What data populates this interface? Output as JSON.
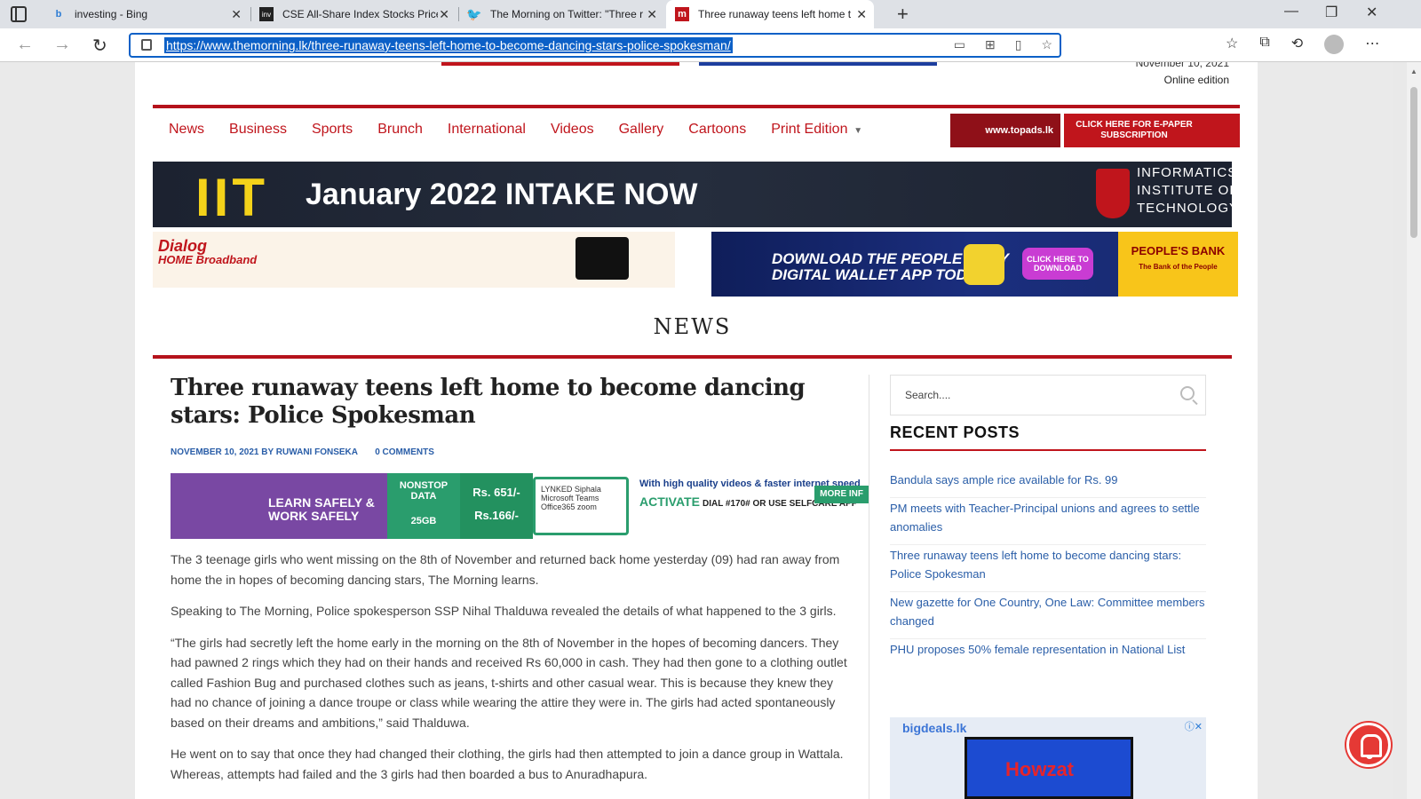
{
  "browser": {
    "tabs": [
      {
        "title": "investing - Bing",
        "favicon": "bing-icon"
      },
      {
        "title": "CSE All-Share Index Stocks Price",
        "favicon": "investing-icon"
      },
      {
        "title": "The Morning on Twitter: \"Three r",
        "favicon": "twitter-icon"
      },
      {
        "title": "Three runaway teens left home t",
        "favicon": "the-morning-icon"
      }
    ],
    "url": "https://www.themorning.lk/three-runaway-teens-left-home-to-become-dancing-stars-police-spokesman/"
  },
  "header": {
    "date": "November 10, 2021",
    "edition": "Online edition"
  },
  "nav": {
    "items": [
      "News",
      "Business",
      "Sports",
      "Brunch",
      "International",
      "Videos",
      "Gallery",
      "Cartoons",
      "Print Edition"
    ],
    "topads": "www.topads.lk",
    "epaper": "CLICK HERE FOR E-PAPER SUBSCRIPTION"
  },
  "banners": {
    "iit_logo": "IIT",
    "iit_text": "January 2022 INTAKE NOW",
    "iit_institute": [
      "INFORMATICS",
      "INSTITUTE OF",
      "TECHNOLOGY"
    ],
    "dialog_brand": "Dialog",
    "dialog_sub": "HOME Broadband",
    "peoples_text": [
      "DOWNLOAD THE PEOPLE'S PAY",
      "DIGITAL WALLET APP TODAY"
    ],
    "peoples_cta": "CLICK HERE TO DOWNLOAD",
    "peoples_bank": "PEOPLE'S BANK",
    "peoples_tagline": "The Bank of the People"
  },
  "section": {
    "title": "NEWS"
  },
  "article": {
    "headline": "Three runaway teens left home to become dancing stars: Police Spokesman",
    "date": "NOVEMBER 10, 2021",
    "by": "BY",
    "author": "RUWANI FONSEKA",
    "comments": "0 COMMENTS",
    "ad": {
      "learn": "LEARN SAFELY & WORK SAFELY",
      "nonstop": "NONSTOP DATA",
      "gb": "25GB",
      "price1": "Rs. 651/-",
      "price2": "Rs.166/-",
      "apps": "LYNKED Siphala Microsoft Teams Office365 zoom",
      "quality": "With high quality videos & faster internet speed",
      "activate": "ACTIVATE",
      "dial": "DIAL #170# OR USE SELFCARE APP",
      "more": "MORE INF"
    },
    "paragraphs": [
      "The 3 teenage girls who went missing on the 8th of November and returned back home yesterday (09) had ran away from home the in hopes of becoming dancing stars, The Morning learns.",
      "Speaking to The Morning, Police spokesperson SSP Nihal Thalduwa revealed the details of what happened to the 3 girls.",
      "“The girls had secretly left the home early in the morning on the 8th of November in the hopes of becoming dancers. They had pawned 2 rings which they had on their hands and received Rs 60,000 in cash. They had then gone to a clothing outlet called Fashion Bug and purchased clothes such as jeans, t-shirts and other casual wear. This is because they knew they had no chance of joining a dance troupe or class while wearing the attire they were in. The girls had acted spontaneously based on their dreams and ambitions,” said Thalduwa.",
      "He went on to say that once they had changed their clothing, the girls had then attempted to join a dance group in Wattala. Whereas, attempts had failed and the 3 girls had then boarded a bus to Anuradhapura."
    ]
  },
  "sidebar": {
    "search_placeholder": "Search....",
    "recent_title": "RECENT POSTS",
    "recent_posts": [
      "Bandula says ample rice available for Rs. 99",
      "PM meets with Teacher-Principal unions and agrees to settle anomalies",
      "Three runaway teens left home to become dancing stars: Police Spokesman",
      "New gazette for One Country, One Law: Committee members changed",
      "PHU proposes 50% female representation in National List"
    ],
    "ad_brand": "bigdeals.lk",
    "ad_text": "Howzat"
  },
  "colors": {
    "accent": "#c0151c",
    "link": "#2a5ea8",
    "url_highlight": "#0c60c7"
  }
}
